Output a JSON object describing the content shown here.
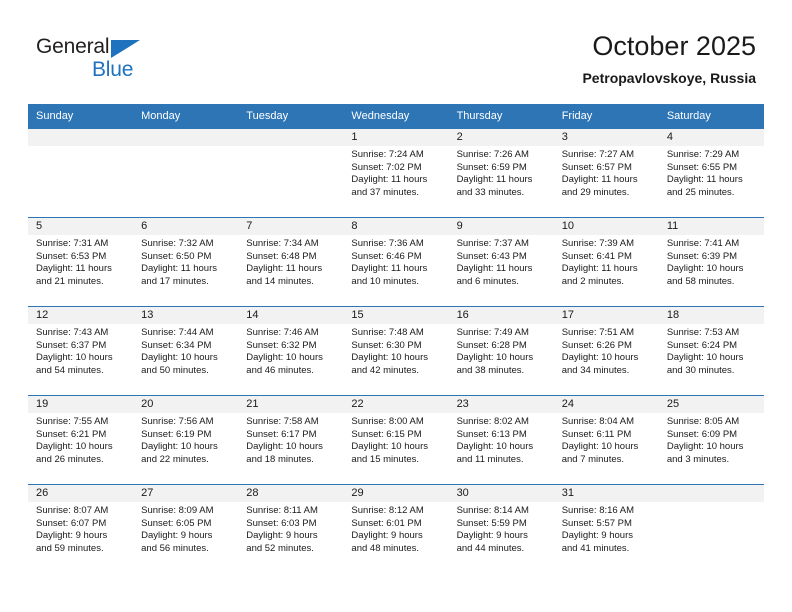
{
  "brand": {
    "name_part1": "General",
    "name_part2": "Blue",
    "accent_color": "#1f72bd"
  },
  "header": {
    "title": "October 2025",
    "subtitle": "Petropavlovskoye, Russia"
  },
  "theme": {
    "header_bg": "#2e75b6",
    "daynum_bg": "#f2f2f2",
    "text": "#1a1a1a"
  },
  "weekdays": [
    "Sunday",
    "Monday",
    "Tuesday",
    "Wednesday",
    "Thursday",
    "Friday",
    "Saturday"
  ],
  "weeks": [
    [
      {
        "day": "",
        "empty": true,
        "sunrise": "",
        "sunset": "",
        "daylight_line1": "",
        "daylight_line2": ""
      },
      {
        "day": "",
        "empty": true,
        "sunrise": "",
        "sunset": "",
        "daylight_line1": "",
        "daylight_line2": ""
      },
      {
        "day": "",
        "empty": true,
        "sunrise": "",
        "sunset": "",
        "daylight_line1": "",
        "daylight_line2": ""
      },
      {
        "day": "1",
        "empty": false,
        "sunrise": "Sunrise: 7:24 AM",
        "sunset": "Sunset: 7:02 PM",
        "daylight_line1": "Daylight: 11 hours",
        "daylight_line2": "and 37 minutes."
      },
      {
        "day": "2",
        "empty": false,
        "sunrise": "Sunrise: 7:26 AM",
        "sunset": "Sunset: 6:59 PM",
        "daylight_line1": "Daylight: 11 hours",
        "daylight_line2": "and 33 minutes."
      },
      {
        "day": "3",
        "empty": false,
        "sunrise": "Sunrise: 7:27 AM",
        "sunset": "Sunset: 6:57 PM",
        "daylight_line1": "Daylight: 11 hours",
        "daylight_line2": "and 29 minutes."
      },
      {
        "day": "4",
        "empty": false,
        "sunrise": "Sunrise: 7:29 AM",
        "sunset": "Sunset: 6:55 PM",
        "daylight_line1": "Daylight: 11 hours",
        "daylight_line2": "and 25 minutes."
      }
    ],
    [
      {
        "day": "5",
        "empty": false,
        "sunrise": "Sunrise: 7:31 AM",
        "sunset": "Sunset: 6:53 PM",
        "daylight_line1": "Daylight: 11 hours",
        "daylight_line2": "and 21 minutes."
      },
      {
        "day": "6",
        "empty": false,
        "sunrise": "Sunrise: 7:32 AM",
        "sunset": "Sunset: 6:50 PM",
        "daylight_line1": "Daylight: 11 hours",
        "daylight_line2": "and 17 minutes."
      },
      {
        "day": "7",
        "empty": false,
        "sunrise": "Sunrise: 7:34 AM",
        "sunset": "Sunset: 6:48 PM",
        "daylight_line1": "Daylight: 11 hours",
        "daylight_line2": "and 14 minutes."
      },
      {
        "day": "8",
        "empty": false,
        "sunrise": "Sunrise: 7:36 AM",
        "sunset": "Sunset: 6:46 PM",
        "daylight_line1": "Daylight: 11 hours",
        "daylight_line2": "and 10 minutes."
      },
      {
        "day": "9",
        "empty": false,
        "sunrise": "Sunrise: 7:37 AM",
        "sunset": "Sunset: 6:43 PM",
        "daylight_line1": "Daylight: 11 hours",
        "daylight_line2": "and 6 minutes."
      },
      {
        "day": "10",
        "empty": false,
        "sunrise": "Sunrise: 7:39 AM",
        "sunset": "Sunset: 6:41 PM",
        "daylight_line1": "Daylight: 11 hours",
        "daylight_line2": "and 2 minutes."
      },
      {
        "day": "11",
        "empty": false,
        "sunrise": "Sunrise: 7:41 AM",
        "sunset": "Sunset: 6:39 PM",
        "daylight_line1": "Daylight: 10 hours",
        "daylight_line2": "and 58 minutes."
      }
    ],
    [
      {
        "day": "12",
        "empty": false,
        "sunrise": "Sunrise: 7:43 AM",
        "sunset": "Sunset: 6:37 PM",
        "daylight_line1": "Daylight: 10 hours",
        "daylight_line2": "and 54 minutes."
      },
      {
        "day": "13",
        "empty": false,
        "sunrise": "Sunrise: 7:44 AM",
        "sunset": "Sunset: 6:34 PM",
        "daylight_line1": "Daylight: 10 hours",
        "daylight_line2": "and 50 minutes."
      },
      {
        "day": "14",
        "empty": false,
        "sunrise": "Sunrise: 7:46 AM",
        "sunset": "Sunset: 6:32 PM",
        "daylight_line1": "Daylight: 10 hours",
        "daylight_line2": "and 46 minutes."
      },
      {
        "day": "15",
        "empty": false,
        "sunrise": "Sunrise: 7:48 AM",
        "sunset": "Sunset: 6:30 PM",
        "daylight_line1": "Daylight: 10 hours",
        "daylight_line2": "and 42 minutes."
      },
      {
        "day": "16",
        "empty": false,
        "sunrise": "Sunrise: 7:49 AM",
        "sunset": "Sunset: 6:28 PM",
        "daylight_line1": "Daylight: 10 hours",
        "daylight_line2": "and 38 minutes."
      },
      {
        "day": "17",
        "empty": false,
        "sunrise": "Sunrise: 7:51 AM",
        "sunset": "Sunset: 6:26 PM",
        "daylight_line1": "Daylight: 10 hours",
        "daylight_line2": "and 34 minutes."
      },
      {
        "day": "18",
        "empty": false,
        "sunrise": "Sunrise: 7:53 AM",
        "sunset": "Sunset: 6:24 PM",
        "daylight_line1": "Daylight: 10 hours",
        "daylight_line2": "and 30 minutes."
      }
    ],
    [
      {
        "day": "19",
        "empty": false,
        "sunrise": "Sunrise: 7:55 AM",
        "sunset": "Sunset: 6:21 PM",
        "daylight_line1": "Daylight: 10 hours",
        "daylight_line2": "and 26 minutes."
      },
      {
        "day": "20",
        "empty": false,
        "sunrise": "Sunrise: 7:56 AM",
        "sunset": "Sunset: 6:19 PM",
        "daylight_line1": "Daylight: 10 hours",
        "daylight_line2": "and 22 minutes."
      },
      {
        "day": "21",
        "empty": false,
        "sunrise": "Sunrise: 7:58 AM",
        "sunset": "Sunset: 6:17 PM",
        "daylight_line1": "Daylight: 10 hours",
        "daylight_line2": "and 18 minutes."
      },
      {
        "day": "22",
        "empty": false,
        "sunrise": "Sunrise: 8:00 AM",
        "sunset": "Sunset: 6:15 PM",
        "daylight_line1": "Daylight: 10 hours",
        "daylight_line2": "and 15 minutes."
      },
      {
        "day": "23",
        "empty": false,
        "sunrise": "Sunrise: 8:02 AM",
        "sunset": "Sunset: 6:13 PM",
        "daylight_line1": "Daylight: 10 hours",
        "daylight_line2": "and 11 minutes."
      },
      {
        "day": "24",
        "empty": false,
        "sunrise": "Sunrise: 8:04 AM",
        "sunset": "Sunset: 6:11 PM",
        "daylight_line1": "Daylight: 10 hours",
        "daylight_line2": "and 7 minutes."
      },
      {
        "day": "25",
        "empty": false,
        "sunrise": "Sunrise: 8:05 AM",
        "sunset": "Sunset: 6:09 PM",
        "daylight_line1": "Daylight: 10 hours",
        "daylight_line2": "and 3 minutes."
      }
    ],
    [
      {
        "day": "26",
        "empty": false,
        "sunrise": "Sunrise: 8:07 AM",
        "sunset": "Sunset: 6:07 PM",
        "daylight_line1": "Daylight: 9 hours",
        "daylight_line2": "and 59 minutes."
      },
      {
        "day": "27",
        "empty": false,
        "sunrise": "Sunrise: 8:09 AM",
        "sunset": "Sunset: 6:05 PM",
        "daylight_line1": "Daylight: 9 hours",
        "daylight_line2": "and 56 minutes."
      },
      {
        "day": "28",
        "empty": false,
        "sunrise": "Sunrise: 8:11 AM",
        "sunset": "Sunset: 6:03 PM",
        "daylight_line1": "Daylight: 9 hours",
        "daylight_line2": "and 52 minutes."
      },
      {
        "day": "29",
        "empty": false,
        "sunrise": "Sunrise: 8:12 AM",
        "sunset": "Sunset: 6:01 PM",
        "daylight_line1": "Daylight: 9 hours",
        "daylight_line2": "and 48 minutes."
      },
      {
        "day": "30",
        "empty": false,
        "sunrise": "Sunrise: 8:14 AM",
        "sunset": "Sunset: 5:59 PM",
        "daylight_line1": "Daylight: 9 hours",
        "daylight_line2": "and 44 minutes."
      },
      {
        "day": "31",
        "empty": false,
        "sunrise": "Sunrise: 8:16 AM",
        "sunset": "Sunset: 5:57 PM",
        "daylight_line1": "Daylight: 9 hours",
        "daylight_line2": "and 41 minutes."
      },
      {
        "day": "",
        "empty": true,
        "sunrise": "",
        "sunset": "",
        "daylight_line1": "",
        "daylight_line2": ""
      }
    ]
  ]
}
